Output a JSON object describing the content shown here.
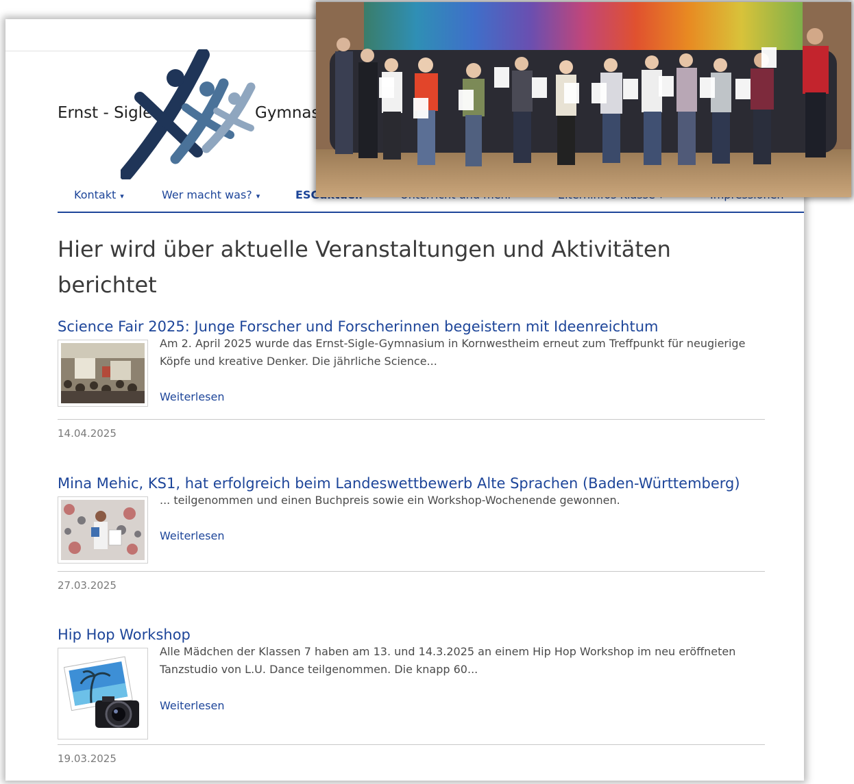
{
  "logo": {
    "text_left": "Ernst - Sigle -",
    "text_right": "Gymnas"
  },
  "nav": {
    "items": [
      {
        "label": "Kontakt",
        "caret": "▾"
      },
      {
        "label": "Wer macht was?",
        "caret": "▾"
      },
      {
        "label": "ESGaktuell"
      },
      {
        "label": "Unterricht und mehr"
      },
      {
        "label": "Elterninfos Klasse",
        "caret": "▾"
      },
      {
        "label": "Impressionen"
      }
    ],
    "accent_color": "#1d4599"
  },
  "photo_overlay": {
    "subject": "group photo of students holding certificates in front of a colorful wall"
  },
  "page": {
    "heading": "Hier wird über aktuelle Veranstaltungen und Aktivitäten berichtet"
  },
  "articles": [
    {
      "title": "Science Fair 2025: Junge Forscher und Forscherinnen begeistern mit Ideenreichtum",
      "teaser": "Am 2. April 2025 wurde das Ernst-Sigle-Gymnasium in Kornwestheim erneut zum Treffpunkt für neugierige Köpfe und kreative Denker. Die jährliche Science...",
      "more": "Weiterlesen",
      "date": "14.04.2025",
      "thumb_icon": "science-fair-photo"
    },
    {
      "title": "Mina Mehic, KS1, hat erfolgreich beim Landeswettbewerb Alte Sprachen (Baden-Württemberg)",
      "teaser": "... teilgenommen und einen Buchpreis sowie ein Workshop-Wochenende gewonnen.",
      "more": "Weiterlesen",
      "date": "27.03.2025",
      "thumb_icon": "student-award-photo"
    },
    {
      "title": "Hip Hop Workshop",
      "teaser": "Alle Mädchen der Klassen 7 haben am 13. und 14.3.2025 an einem Hip Hop Workshop im neu eröffneten Tanzstudio von L.U. Dance teilgenommen. Die knapp 60...",
      "more": "Weiterlesen",
      "date": "19.03.2025",
      "thumb_icon": "camera-photo-icon"
    }
  ]
}
